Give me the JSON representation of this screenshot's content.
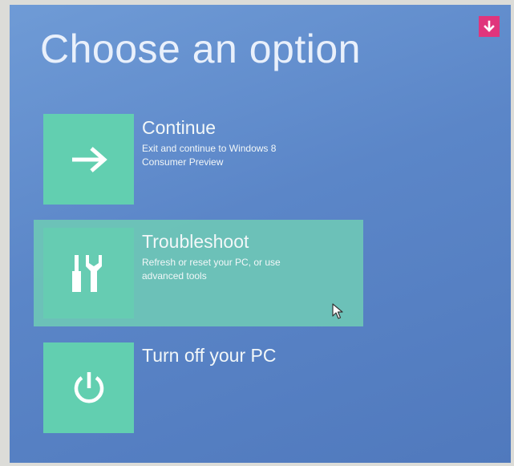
{
  "page": {
    "title": "Choose an option"
  },
  "options": [
    {
      "title": "Continue",
      "description": "Exit and continue to Windows 8 Consumer Preview",
      "icon": "arrow-right-icon"
    },
    {
      "title": "Troubleshoot",
      "description": "Refresh or reset your PC, or use advanced tools",
      "icon": "tools-icon"
    },
    {
      "title": "Turn off your PC",
      "description": "",
      "icon": "power-icon"
    }
  ],
  "corner_button": {
    "icon": "arrow-down-icon"
  },
  "colors": {
    "background": "#5b86c8",
    "tile": "#62cfb0",
    "highlight": "#6ec7b6",
    "accent": "#e0357c",
    "text": "#f2f7f8"
  }
}
